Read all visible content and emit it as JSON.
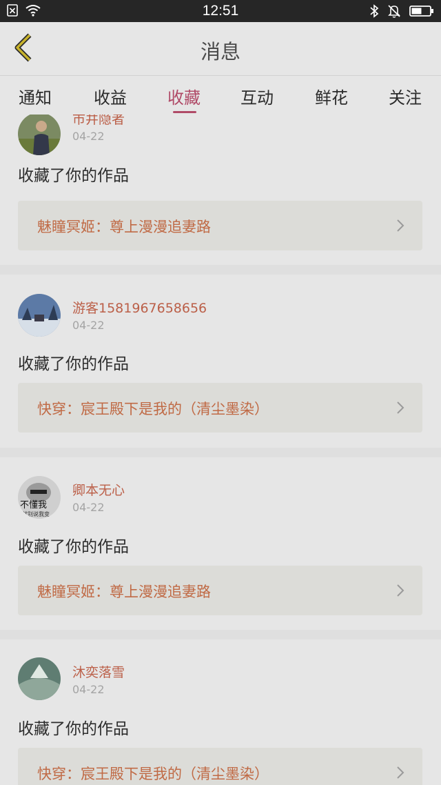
{
  "status_bar": {
    "time": "12:51",
    "icons": [
      "sim-blocked-icon",
      "wifi-icon",
      "bluetooth-icon",
      "notifications-muted-icon",
      "battery-icon"
    ]
  },
  "header": {
    "title": "消息",
    "back_icon": "chevron-left-icon"
  },
  "tabs": [
    {
      "label": "通知",
      "active": false
    },
    {
      "label": "收益",
      "active": false
    },
    {
      "label": "收藏",
      "active": true
    },
    {
      "label": "互动",
      "active": false
    },
    {
      "label": "鲜花",
      "active": false
    },
    {
      "label": "关注",
      "active": false
    }
  ],
  "colors": {
    "accent": "#b04a67",
    "username": "#bb5f48",
    "work_title": "#c06a45"
  },
  "items": [
    {
      "username": "市井隐者",
      "date": "04-22",
      "action": "收藏了你的作品",
      "work": "魅瞳冥姬：尊上漫漫追妻路"
    },
    {
      "username": "游客1581967658656",
      "date": "04-22",
      "action": "收藏了你的作品",
      "work": "快穿：宸王殿下是我的（清尘墨染）"
    },
    {
      "username": "卿本无心",
      "date": "04-22",
      "action": "收藏了你的作品",
      "work": "魅瞳冥姬：尊上漫漫追妻路",
      "avatar_text_1": "不懂我",
      "avatar_text_2": "就别说我变"
    },
    {
      "username": "沐奕落雪",
      "date": "04-22",
      "action": "收藏了你的作品",
      "work": "快穿：宸王殿下是我的（清尘墨染）"
    }
  ]
}
